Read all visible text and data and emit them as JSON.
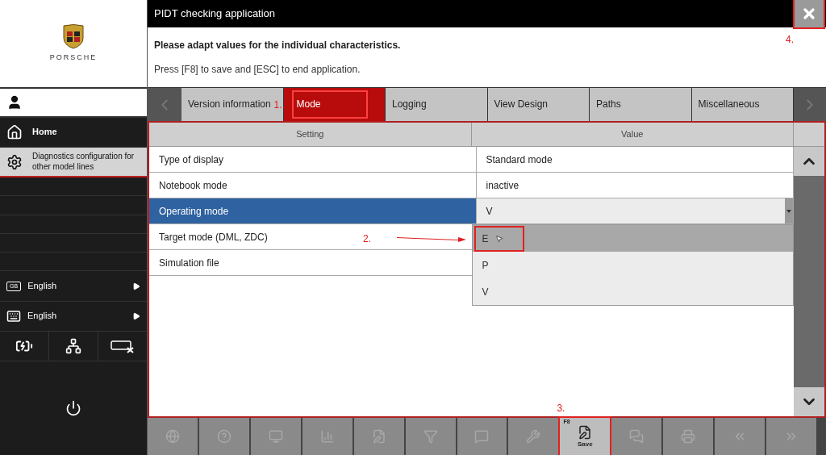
{
  "sidebar": {
    "logo_text": "PORSCHE",
    "items": [
      {
        "label": "Home",
        "selected": false
      },
      {
        "label": "Diagnostics configuration for other model lines",
        "selected": true
      }
    ],
    "languages": [
      {
        "badge": "GB",
        "label": "English"
      },
      {
        "label": "English"
      }
    ]
  },
  "window": {
    "title": "PIDT checking application",
    "close_annotation": "4."
  },
  "header": {
    "heading": "Please adapt values for the individual characteristics.",
    "instruction": "Press [F8] to save and [ESC] to end application."
  },
  "tabs": [
    {
      "label": "Version information",
      "selected": false
    },
    {
      "label": "Mode",
      "selected": true,
      "annotation": "1."
    },
    {
      "label": "Logging",
      "selected": false
    },
    {
      "label": "View Design",
      "selected": false
    },
    {
      "label": "Paths",
      "selected": false
    },
    {
      "label": "Miscellaneous",
      "selected": false
    }
  ],
  "table": {
    "columns": [
      "Setting",
      "Value"
    ],
    "rows": [
      {
        "setting": "Type of display",
        "value": "Standard mode",
        "selected": false
      },
      {
        "setting": "Notebook mode",
        "value": "inactive",
        "selected": false
      },
      {
        "setting": "Operating mode",
        "value": "V",
        "selected": true,
        "dropdown": true
      },
      {
        "setting": "Target mode (DML, ZDC)",
        "selected": false
      },
      {
        "setting": "Simulation file",
        "selected": false
      }
    ],
    "dropdown_options": [
      {
        "label": "E",
        "selected": true,
        "annotation": "2."
      },
      {
        "label": "P",
        "selected": false
      },
      {
        "label": "V",
        "selected": false
      }
    ]
  },
  "toolbar": [
    {
      "disabled": true
    },
    {
      "disabled": true
    },
    {
      "disabled": true
    },
    {
      "disabled": true
    },
    {
      "disabled": true
    },
    {
      "disabled": true
    },
    {
      "disabled": true
    },
    {
      "disabled": true
    },
    {
      "key": "F8",
      "label": "Save",
      "disabled": false,
      "annotation": "3."
    },
    {
      "disabled": true
    },
    {
      "disabled": true
    },
    {
      "disabled": true
    },
    {
      "disabled": true
    }
  ]
}
